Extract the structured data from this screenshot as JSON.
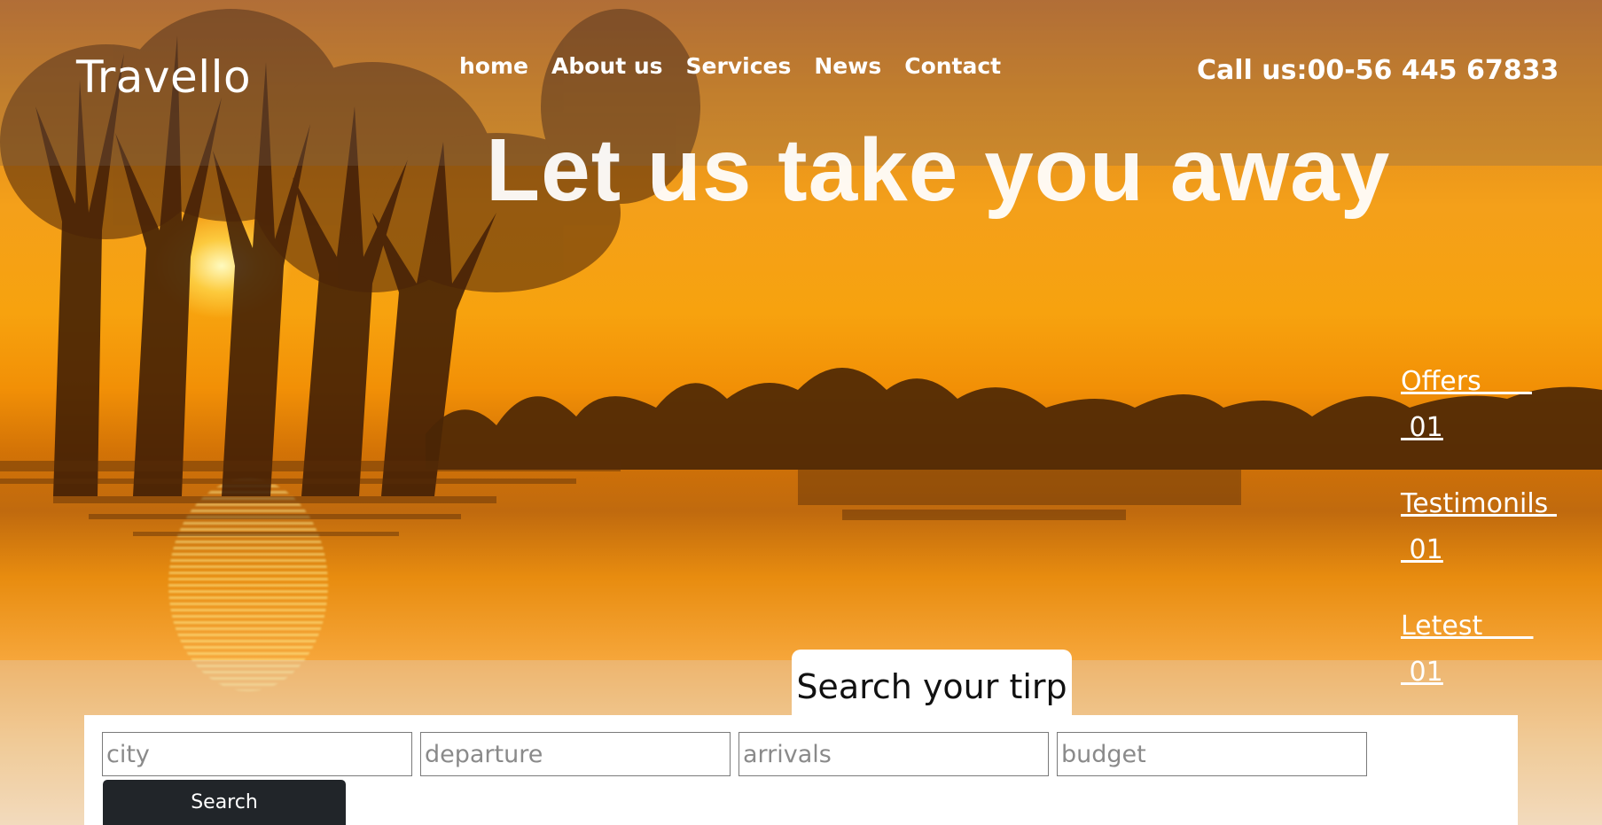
{
  "brand": {
    "logo": "Travello"
  },
  "nav": {
    "items": [
      {
        "label": "home"
      },
      {
        "label": "About us"
      },
      {
        "label": "Services"
      },
      {
        "label": "News"
      },
      {
        "label": "Contact"
      }
    ]
  },
  "header": {
    "phone": "Call us:00-56 445 67833"
  },
  "hero": {
    "headline": "Let us take you away"
  },
  "side_links": [
    {
      "label": "Offers      ",
      "number": " 01"
    },
    {
      "label": "Testimonils ",
      "number": " 01"
    },
    {
      "label": "Letest      ",
      "number": " 01"
    }
  ],
  "search": {
    "title": "Search your tirp",
    "fields": {
      "city": {
        "placeholder": "city",
        "value": ""
      },
      "departure": {
        "placeholder": "departure",
        "value": ""
      },
      "arrivals": {
        "placeholder": "arrivals",
        "value": ""
      },
      "budget": {
        "placeholder": "budget",
        "value": ""
      }
    },
    "button_label": "Search"
  },
  "colors": {
    "sky_top": "#c8722a",
    "sky_mid": "#f7a20e",
    "button_dark": "#212529",
    "text_light": "#ffffff"
  }
}
